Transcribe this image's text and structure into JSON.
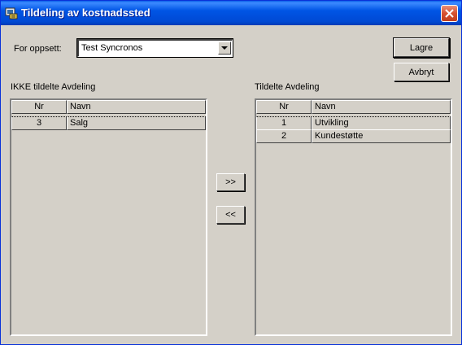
{
  "window": {
    "title": "Tildeling av kostnadssted"
  },
  "setup": {
    "label": "For oppsett:",
    "selected": "Test Syncronos"
  },
  "buttons": {
    "save": "Lagre",
    "cancel": "Avbryt",
    "move_right": ">>",
    "move_left": "<<"
  },
  "unassigned": {
    "heading": "IKKE tildelte Avdeling",
    "columns": {
      "nr": "Nr",
      "name": "Navn"
    },
    "rows": [
      {
        "nr": "3",
        "name": "Salg"
      }
    ]
  },
  "assigned": {
    "heading": "Tildelte Avdeling",
    "columns": {
      "nr": "Nr",
      "name": "Navn"
    },
    "rows": [
      {
        "nr": "1",
        "name": "Utvikling"
      },
      {
        "nr": "2",
        "name": "Kundestøtte"
      }
    ]
  }
}
